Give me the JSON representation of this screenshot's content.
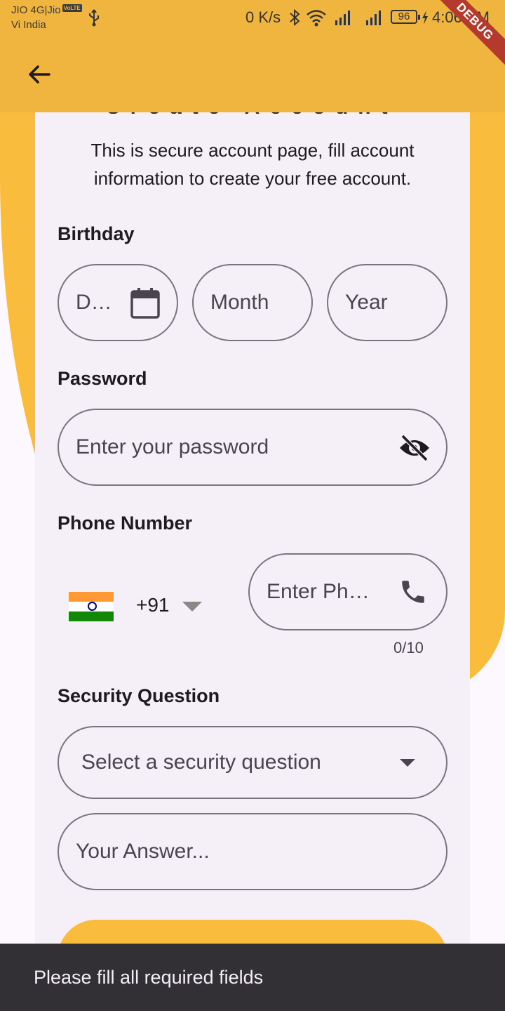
{
  "status_bar": {
    "carrier_line1": "JIO 4G|Jio",
    "volte_badge": "VoLTE",
    "carrier_line2": "Vi India",
    "net_speed": "0 K/s",
    "battery": "96",
    "time": "4:06 PM"
  },
  "debug_banner": "DEBUG",
  "card": {
    "heading": "Create Account",
    "intro": "This is secure account page, fill account information to create your free account."
  },
  "birthday": {
    "label": "Birthday",
    "day_placeholder": "D…",
    "month_placeholder": "Month",
    "year_placeholder": "Year"
  },
  "password": {
    "label": "Password",
    "placeholder": "Enter your password"
  },
  "phone": {
    "label": "Phone Number",
    "dial_code": "+91",
    "placeholder": "Enter Ph…",
    "counter": "0/10"
  },
  "security": {
    "label": "Security Question",
    "select_placeholder": "Select a security question",
    "answer_placeholder": "Your Answer..."
  },
  "snackbar": {
    "message": "Please fill all required fields"
  },
  "colors": {
    "accent": "#f9bc3d",
    "appbar": "#efb53f",
    "card": "#f5eff7",
    "outline": "#79747e",
    "snackbar": "#322f35"
  },
  "icons": [
    "back-arrow-icon",
    "calendar-icon",
    "visibility-off-icon",
    "phone-icon",
    "dropdown-arrow-icon",
    "india-flag-icon",
    "usb-icon",
    "bluetooth-icon",
    "wifi-icon",
    "signal-icon",
    "battery-icon"
  ]
}
